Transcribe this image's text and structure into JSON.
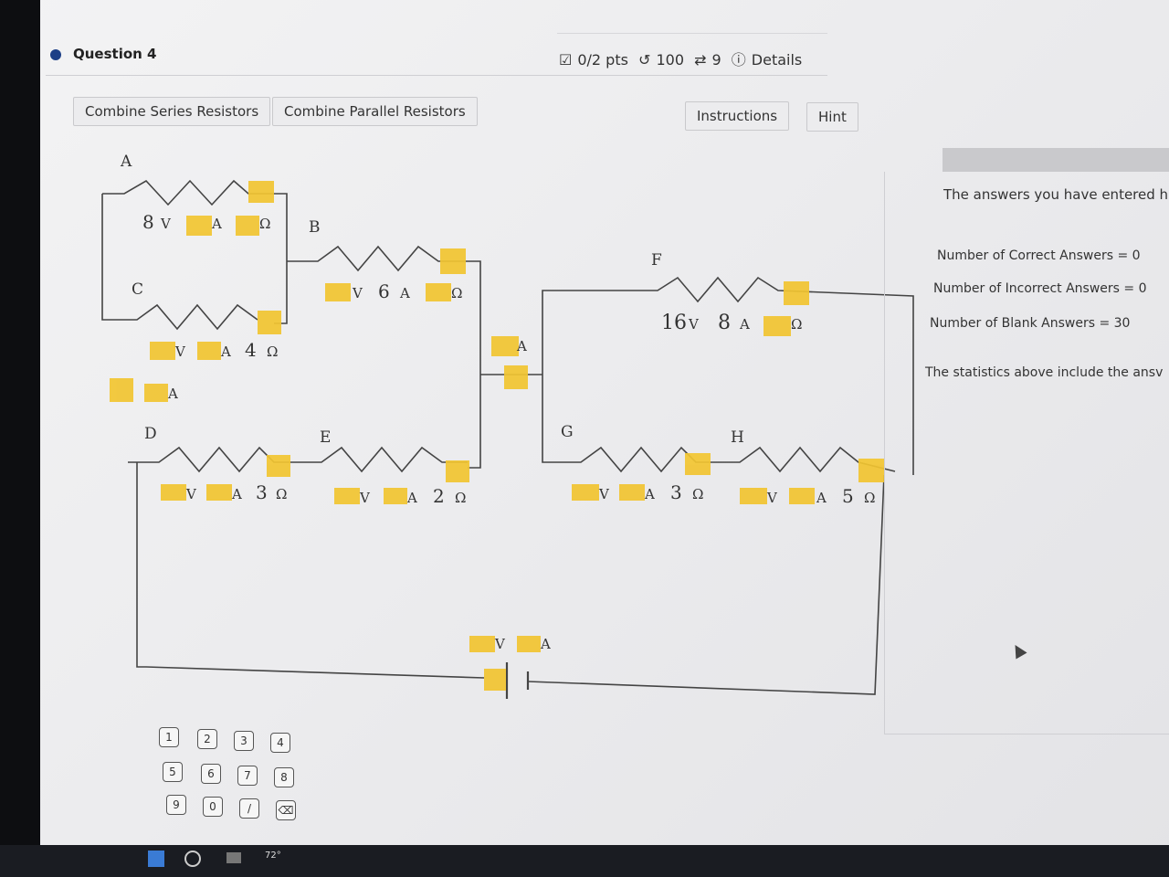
{
  "question": {
    "title": "Question 4"
  },
  "status": {
    "points": "0/2 pts",
    "attempts": "100",
    "retries": "9",
    "details": "Details"
  },
  "toolbar": {
    "combine_series": "Combine Series Resistors",
    "combine_parallel": "Combine Parallel Resistors",
    "instructions": "Instructions",
    "hint": "Hint"
  },
  "circuit": {
    "labels": {
      "A": "A",
      "B": "B",
      "C": "C",
      "D": "D",
      "E": "E",
      "F": "F",
      "G": "G",
      "H": "H"
    },
    "unit_v": "V",
    "unit_a": "A",
    "unit_ohm": "Ω",
    "resistors": {
      "A": {
        "voltage": "8",
        "current": "",
        "resistance": ""
      },
      "B": {
        "voltage": "",
        "current": "6",
        "resistance": ""
      },
      "C": {
        "voltage": "",
        "current": "",
        "resistance": "4"
      },
      "D": {
        "voltage": "",
        "current": "",
        "resistance": "3"
      },
      "E": {
        "voltage": "",
        "current": "",
        "resistance": "2"
      },
      "F": {
        "voltage": "16",
        "current": "8",
        "resistance": ""
      },
      "G": {
        "voltage": "",
        "current": "",
        "resistance": "3"
      },
      "H": {
        "voltage": "",
        "current": "",
        "resistance": "5"
      }
    }
  },
  "results": {
    "entered": "The answers you have entered h",
    "correct": "Number of Correct Answers = 0",
    "incorrect": "Number of Incorrect Answers = 0",
    "blank": "Number of Blank Answers = 30",
    "note": "The statistics above include the ansv"
  },
  "keypad": {
    "keys": [
      "1",
      "2",
      "3",
      "4",
      "5",
      "6",
      "7",
      "8",
      "9",
      "0",
      "/",
      "⌫"
    ]
  },
  "taskbar": {
    "temp": "72°"
  },
  "colors": {
    "highlight": "#f2c531",
    "wire": "#444444",
    "accent": "#1d3f86"
  }
}
